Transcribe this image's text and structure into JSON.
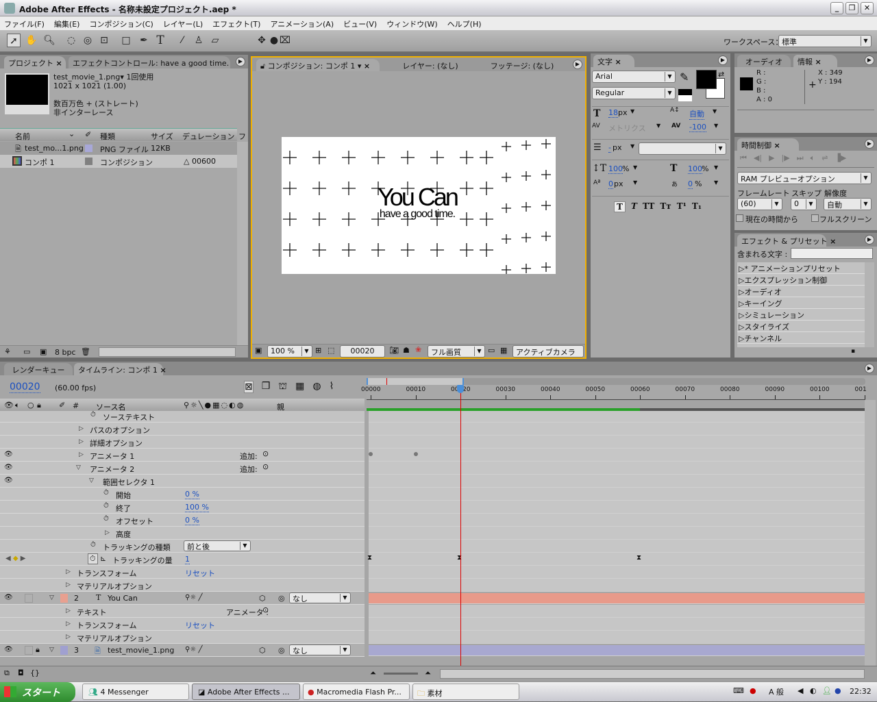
{
  "window": {
    "title": "Adobe After Effects - 名称未設定プロジェクト.aep *",
    "min": "_",
    "max": "❐",
    "close": "✕"
  },
  "menu": [
    "ファイル(F)",
    "編集(E)",
    "コンポジション(C)",
    "レイヤー(L)",
    "エフェクト(T)",
    "アニメーション(A)",
    "ビュー(V)",
    "ウィンドウ(W)",
    "ヘルプ(H)"
  ],
  "toolbar": {
    "workspace_label": "ワークスペース：",
    "workspace_value": "標準"
  },
  "project": {
    "tab": "プロジェクト",
    "tab2": "エフェクトコントロール: have a good time.",
    "info_name": "test_movie_1.png▾ 1回使用",
    "info_size": "1021 x 1021 (1.00)",
    "info_color": "数百万色 + (ストレート)",
    "info_interlace": "非インターレース",
    "columns": [
      "名前",
      "種類",
      "サイズ",
      "デュレーション",
      "ファ"
    ],
    "items": [
      {
        "name": "test_mo...1.png",
        "type": "PNG ファイル",
        "size": "12KB",
        "duration": "",
        "label_color": "#a8a8d8"
      },
      {
        "name": "コンポ 1",
        "type": "コンポジション",
        "size": "",
        "duration": "△ 00600",
        "label_color": "#808080"
      }
    ],
    "bpc": "8 bpc"
  },
  "comp": {
    "tab": "コンポジション: コンポ 1",
    "tab_layer": "レイヤー: (なし)",
    "tab_footage": "フッテージ: (なし)",
    "text_main": "You Can",
    "text_sub": "have a good time.",
    "zoom": "100 %",
    "timecode": "00020",
    "quality": "フル画質",
    "camera": "アクティブカメラ"
  },
  "character": {
    "tab": "文字",
    "font": "Arial",
    "style": "Regular",
    "size": "18",
    "size_unit": "px",
    "leading": "自動",
    "kerning": "メトリクス",
    "tracking": "-100",
    "stroke": "-",
    "stroke_unit": "px",
    "vscale": "100",
    "hscale": "100",
    "pct": "%",
    "baseline": "0",
    "baseline_unit": "px",
    "tsume": "0",
    "tsume_unit": "%",
    "fill_color": "#000000"
  },
  "info": {
    "tab_audio": "オーディオ",
    "tab": "情報",
    "r": "R :",
    "g": "G :",
    "b": "B :",
    "a": "A : 0",
    "x": "X : 349",
    "y": "Y : 194"
  },
  "time_control": {
    "tab": "時間制御",
    "ram": "RAM プレビューオプション",
    "fps_label": "フレームレート",
    "skip_label": "スキップ",
    "res_label": "解像度",
    "fps": "(60)",
    "skip": "0",
    "res": "自動",
    "from_current": "現在の時間から",
    "fullscreen": "フルスクリーン"
  },
  "effects": {
    "tab": "エフェクト & プリセット",
    "search_label": "含まれる文字 :",
    "search_value": "",
    "items": [
      "* アニメーションプリセット",
      "エクスプレッション制御",
      "オーディオ",
      "キーイング",
      "シミュレーション",
      "スタイライズ",
      "チャンネル"
    ]
  },
  "timeline": {
    "tab_render": "レンダーキュー",
    "tab": "タイムライン: コンポ 1",
    "timecode": "00020",
    "fps": "(60.00 fps)",
    "col_hash": "#",
    "col_source": "ソース名",
    "col_parent": "親",
    "ruler": [
      "00000",
      "00010",
      "00020",
      "00030",
      "00040",
      "00050",
      "00060",
      "00070",
      "00080",
      "00090",
      "00100",
      "001"
    ],
    "current_frame": 20,
    "work_area_end_frame": 60,
    "rows": [
      {
        "indent": 3,
        "icon": "stopwatch",
        "label": "ソーステキスト"
      },
      {
        "indent": 2,
        "icon": "tri",
        "label": "パスのオプション"
      },
      {
        "indent": 2,
        "icon": "tri",
        "label": "詳細オプション"
      },
      {
        "indent": 2,
        "icon": "tri",
        "label": "アニメータ 1",
        "extra": "追加:",
        "eye": true,
        "keys": [
          0,
          10
        ]
      },
      {
        "indent": 2,
        "icon": "tri-open",
        "label": "アニメータ 2",
        "extra": "追加:",
        "eye": true
      },
      {
        "indent": 3,
        "icon": "tri-open",
        "label": "範囲セレクタ 1",
        "eye": true
      },
      {
        "indent": 4,
        "icon": "stopwatch",
        "label": "開始",
        "value": "0 %"
      },
      {
        "indent": 4,
        "icon": "stopwatch",
        "label": "終了",
        "value": "100 %"
      },
      {
        "indent": 4,
        "icon": "stopwatch",
        "label": "オフセット",
        "value": "0 %"
      },
      {
        "indent": 4,
        "icon": "tri",
        "label": "高度"
      },
      {
        "indent": 3,
        "icon": "stopwatch",
        "label": "トラッキングの種類",
        "dropdown": "前と後"
      },
      {
        "indent": 3,
        "icon": "stopwatch-on",
        "label": "トラッキングの量",
        "value": "1",
        "nav": true,
        "hourglass": [
          0,
          20,
          60
        ]
      },
      {
        "indent": 1,
        "icon": "tri",
        "label": "トランスフォーム",
        "value": "リセット"
      },
      {
        "indent": 1,
        "icon": "tri",
        "label": "マテリアルオプション"
      },
      {
        "layer": true,
        "num": "2",
        "label": "You Can",
        "type": "T",
        "color": "#e8a090",
        "bar": "#e89a8a",
        "parent": "なし",
        "eye": true
      },
      {
        "indent": 1,
        "icon": "tri",
        "label": "テキスト",
        "extra": "アニメータ :"
      },
      {
        "indent": 1,
        "icon": "tri",
        "label": "トランスフォーム",
        "value": "リセット"
      },
      {
        "indent": 1,
        "icon": "tri",
        "label": "マテリアルオプション"
      },
      {
        "layer": true,
        "num": "3",
        "label": "test_movie_1.png",
        "type": "img",
        "color": "#a0a0d0",
        "bar": "#a8a8d0",
        "parent": "なし",
        "eye": true,
        "lock": true
      }
    ]
  },
  "taskbar": {
    "start": "スタート",
    "tasks": [
      "4 Messenger",
      "Adobe After Effects ...",
      "Macromedia Flash Pr...",
      "素材"
    ],
    "ime": "A 般",
    "clock": "22:32"
  }
}
